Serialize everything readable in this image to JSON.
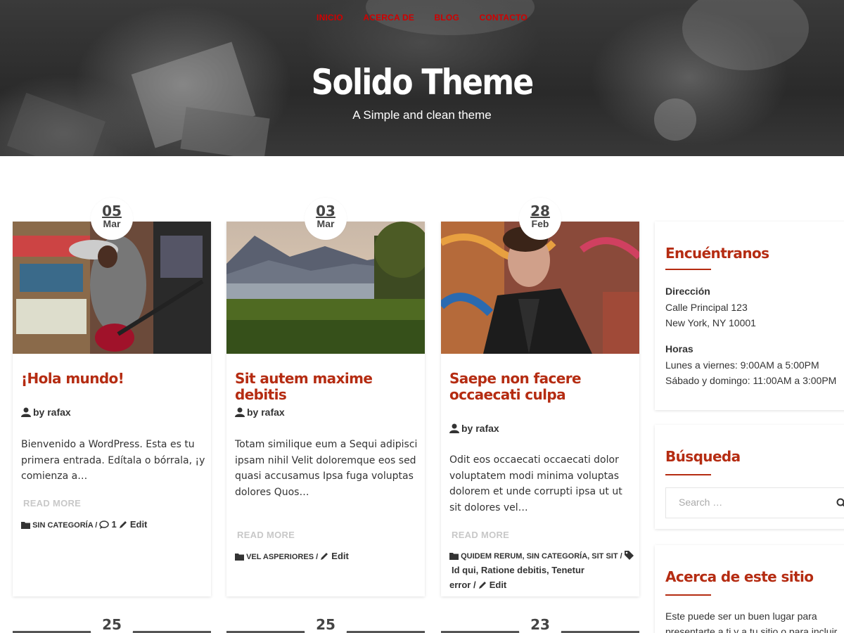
{
  "nav": {
    "items": [
      "INICIO",
      "ACERCA DE",
      "BLOG",
      "CONTACTO"
    ]
  },
  "header": {
    "title": "Solido Theme",
    "tagline": "A Simple and clean theme"
  },
  "posts": [
    {
      "day": "05",
      "month": "Mar",
      "title": "¡Hola mundo!",
      "author": "by rafax",
      "excerpt": "Bienvenido a WordPress. Esta es tu primera entrada. Edítala o bórrala, ¡y comienza a…",
      "read_more": "READ MORE",
      "categories": "SIN CATEGORÍA",
      "comments": "1",
      "edit": "Edit"
    },
    {
      "day": "03",
      "month": "Mar",
      "title": "Sit autem maxime debitis",
      "author": "by rafax",
      "excerpt": "Totam similique eum a Sequi adipisci ipsam nihil Velit doloremque eos sed quasi accusamus Ipsa fuga voluptas dolores Quos…",
      "read_more": "READ MORE",
      "categories": "VEL ASPERIORES",
      "edit": "Edit"
    },
    {
      "day": "28",
      "month": "Feb",
      "title": "Saepe non facere occaecati culpa",
      "author": "by rafax",
      "excerpt": "Odit eos occaecati occaecati dolor voluptatem modi minima voluptas dolorem et unde corrupti ipsa ut ut sit dolores vel…",
      "read_more": "READ MORE",
      "cat1": "QUIDEM RERUM,",
      "cat2": "SIN CATEGORÍA,",
      "cat3": "SIT SIT /",
      "tags1": "Id qui, Ratione debitis, Tenetur",
      "tags2": "error /",
      "edit": "Edit"
    }
  ],
  "more_posts_days": [
    "25",
    "25",
    "23"
  ],
  "sidebar": {
    "find_us": {
      "title": "Encuéntranos",
      "address_label": "Dirección",
      "address_line1": "Calle Principal 123",
      "address_line2": "New York, NY 10001",
      "hours_label": "Horas",
      "hours_line1": "Lunes a viernes: 9:00AM a 5:00PM",
      "hours_line2": "Sábado y domingo: 11:00AM a 3:00PM"
    },
    "search": {
      "title": "Búsqueda",
      "placeholder": "Search …"
    },
    "about": {
      "title": "Acerca de este sitio",
      "text_line1": "Este puede ser un buen lugar para",
      "text_line2": "presentarte a ti y a tu sitio o para incluir"
    }
  },
  "colors": {
    "accent": "#b52c12",
    "nav": "#d10000",
    "muted": "#c8c8c8"
  }
}
